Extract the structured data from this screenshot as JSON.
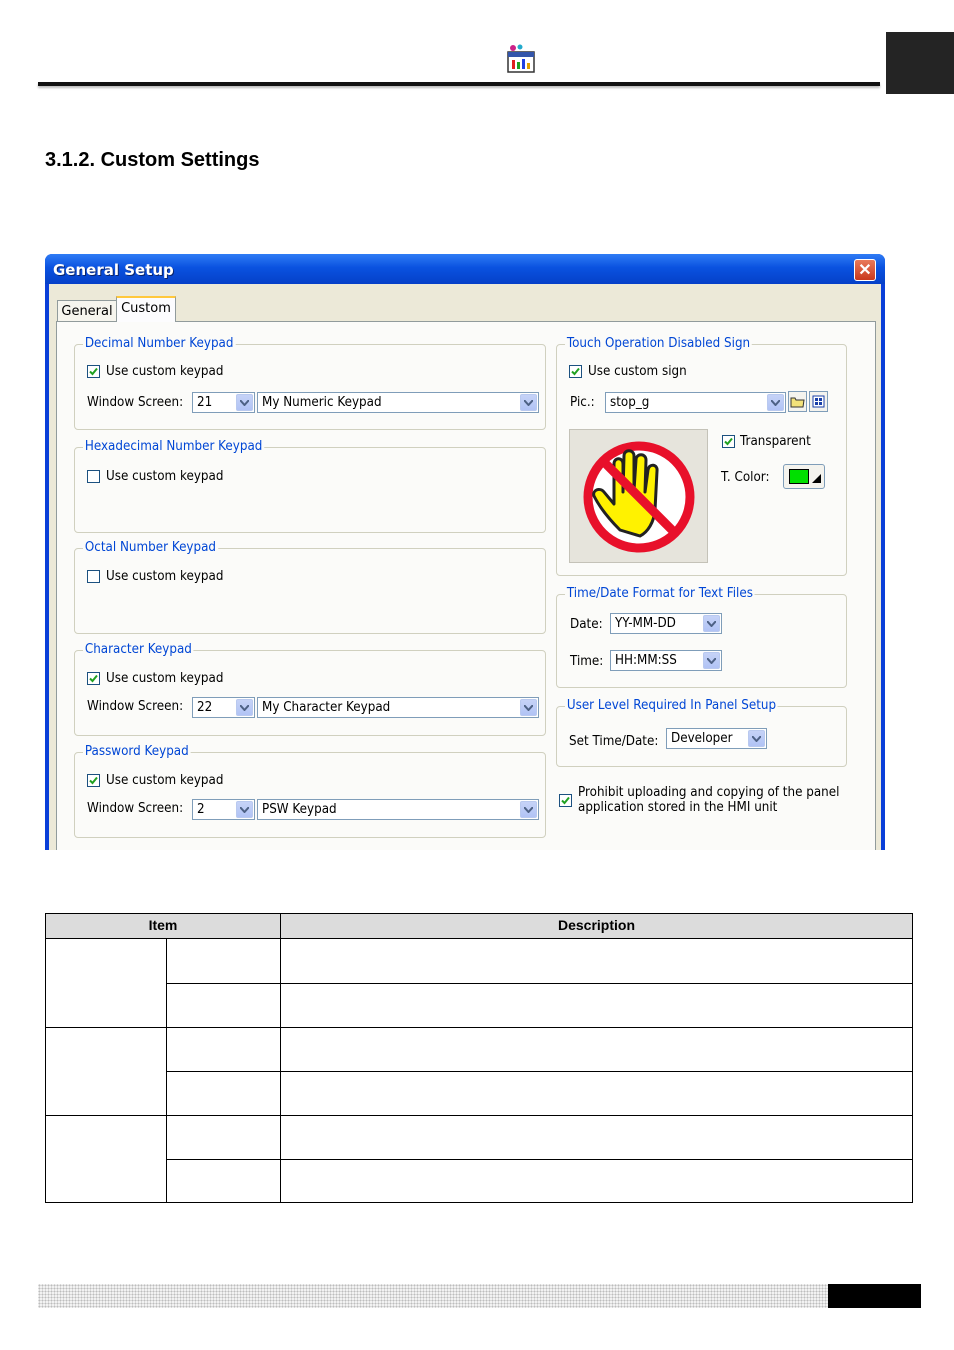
{
  "page": {
    "section_title": "3.1.2. Custom Settings"
  },
  "dialog": {
    "title": "General Setup",
    "close_symbol": "✕",
    "tabs": [
      {
        "label": "General",
        "active": false
      },
      {
        "label": "Custom",
        "active": true
      }
    ],
    "decimal": {
      "label": "Decimal Number Keypad",
      "use_custom_label": "Use custom keypad",
      "checked": true,
      "window_screen_label": "Window Screen:",
      "screen_no": "21",
      "screen_name": "My Numeric Keypad"
    },
    "hex": {
      "label": "Hexadecimal Number Keypad",
      "use_custom_label": "Use custom keypad",
      "checked": false
    },
    "octal": {
      "label": "Octal Number Keypad",
      "use_custom_label": "Use custom keypad",
      "checked": false
    },
    "character": {
      "label": "Character Keypad",
      "use_custom_label": "Use custom keypad",
      "checked": true,
      "window_screen_label": "Window Screen:",
      "screen_no": "22",
      "screen_name": "My Character Keypad"
    },
    "password": {
      "label": "Password Keypad",
      "use_custom_label": "Use custom keypad",
      "checked": true,
      "window_screen_label": "Window Screen:",
      "screen_no": "2",
      "screen_name": "PSW Keypad"
    },
    "touch": {
      "label": "Touch Operation Disabled Sign",
      "use_custom_label": "Use custom sign",
      "checked": true,
      "pic_label": "Pic.:",
      "pic_value": "stop_g",
      "transparent_label": "Transparent",
      "transparent_checked": true,
      "tcolor_label": "T. Color:",
      "tcolor": "#00e000"
    },
    "timedate": {
      "label": "Time/Date Format for Text Files",
      "date_label": "Date:",
      "date_value": "YY-MM-DD",
      "time_label": "Time:",
      "time_value": "HH:MM:SS"
    },
    "userlevel": {
      "label": "User Level Required In Panel Setup",
      "set_label": "Set Time/Date:",
      "value": "Developer"
    },
    "prohibit": {
      "checked": true,
      "line1": "Prohibit uploading and copying of the panel",
      "line2": "application stored in the HMI unit"
    }
  },
  "table": {
    "headers": [
      "Item",
      "Description"
    ]
  },
  "colors": {
    "titlebar": "#0a52e0",
    "group_label": "#0046d5",
    "stop_sign_red": "#e8102a",
    "hand_yellow": "#fff200"
  }
}
